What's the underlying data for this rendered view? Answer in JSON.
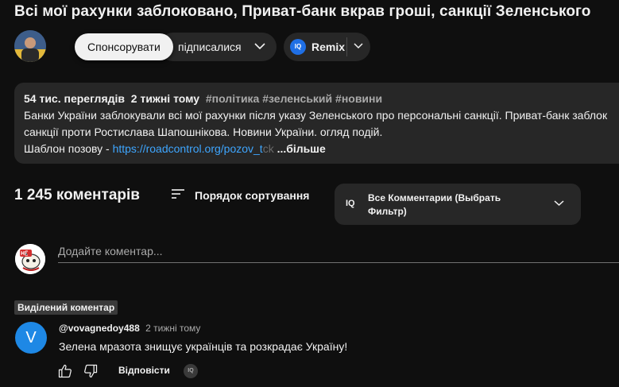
{
  "video": {
    "title": "Всі мої рахунки заблоковано, Приват-банк вкрав гроші, санкції Зеленського"
  },
  "channel": {
    "sponsor_label": "Спонсорувати",
    "subscribed_label": "підписалися",
    "remix_label": "Remix",
    "remix_icon_text": "IQ"
  },
  "description": {
    "views": "54 тис. переглядів",
    "time": "2 тижні тому",
    "tags": "#політика #зеленський #новини",
    "line1": "Банки України заблокували всі мої рахунки після указу Зеленського про персональні санкції. Приват-банк заблок",
    "line2": "санкції проти Ростислава Шапошнікова. Новини України. огляд подій.",
    "line3_prefix": "Шаблон позову - ",
    "link_text": "https://roadcontrol.org/pozov_t",
    "link_fade": "ck",
    "more_label": "...більше"
  },
  "comments": {
    "count_label": "1 245 коментарів",
    "sort_label": "Порядок сортування",
    "filter_icon_text": "IQ",
    "filter_label": "Все Комментарии (Выбрать Фильтр)",
    "add_placeholder": "Додайте коментар...",
    "pinned_label": "Виділений коментар",
    "items": [
      {
        "avatar_letter": "V",
        "author": "@vovagnedoy488",
        "time": "2 тижні тому",
        "text": "Зелена мразота знищує українців та розкрадає Україну!",
        "reply_label": "Відповісти",
        "iq_icon_text": "IQ"
      }
    ]
  },
  "colors": {
    "background": "#0f0f0f",
    "surface": "#272727",
    "link": "#3ea6ff",
    "avatar_v": "#1e88e5",
    "iq_blue": "#1f6fe5"
  }
}
